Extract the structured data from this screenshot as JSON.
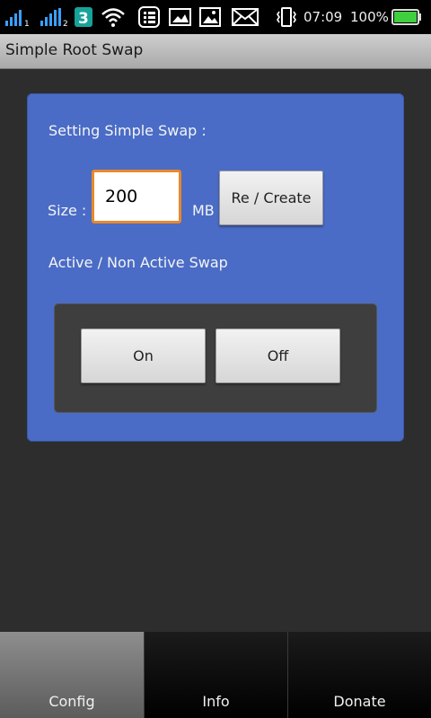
{
  "status_bar": {
    "icons": [
      "signal-1-icon",
      "signal-2-icon",
      "three-network-icon",
      "wifi-icon",
      "notes-icon",
      "image-notification-icon",
      "picture-icon",
      "mail-icon",
      "vibrate-icon",
      "battery-icon"
    ],
    "time": "07:09",
    "battery_percent": "100%",
    "battery_level": 1.0,
    "colors": {
      "battery": "#3fcf3f",
      "signal": "#3aa0ff"
    }
  },
  "app": {
    "title": "Simple Root Swap"
  },
  "settings": {
    "heading": "Setting Simple Swap :",
    "size_label": "Size :",
    "size_value": "200",
    "unit": "MB",
    "recreate_label": "Re / Create",
    "active_heading": "Active / Non Active Swap",
    "on_label": "On",
    "off_label": "Off"
  },
  "tabs": [
    {
      "label": "Config",
      "active": true
    },
    {
      "label": "Info",
      "active": false
    },
    {
      "label": "Donate",
      "active": false
    }
  ],
  "colors": {
    "panel": "#4a6cc6",
    "input_border": "#e8892c",
    "background": "#2d2d2d"
  }
}
